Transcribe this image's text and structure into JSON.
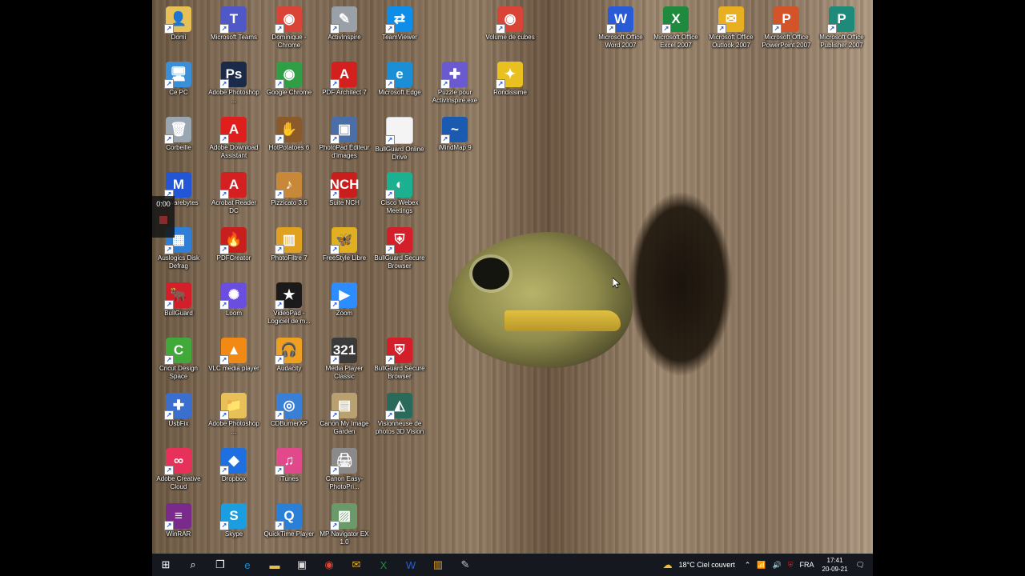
{
  "recorder": {
    "time": "0:00"
  },
  "desktop_icons": [
    {
      "col": 0,
      "row": 0,
      "label": "Domi",
      "icon": "user-folder-icon",
      "color": "#e8c058",
      "glyph": "👤"
    },
    {
      "col": 0,
      "row": 1,
      "label": "Ce PC",
      "icon": "computer-icon",
      "color": "#3a8fd8",
      "glyph": "🖥"
    },
    {
      "col": 0,
      "row": 2,
      "label": "Corbeille",
      "icon": "recycle-bin-icon",
      "color": "#9aa6b0",
      "glyph": "🗑"
    },
    {
      "col": 0,
      "row": 3,
      "label": "Malwarebytes",
      "icon": "malwarebytes-icon",
      "color": "#2256d6",
      "glyph": "M"
    },
    {
      "col": 0,
      "row": 4,
      "label": "Auslogics Disk Defrag",
      "icon": "defrag-icon",
      "color": "#2f7fd6",
      "glyph": "▦"
    },
    {
      "col": 0,
      "row": 5,
      "label": "BullGuard",
      "icon": "bullguard-icon",
      "color": "#d41f2a",
      "glyph": "🐂"
    },
    {
      "col": 0,
      "row": 6,
      "label": "Cricut Design Space",
      "icon": "cricut-icon",
      "color": "#41a83a",
      "glyph": "C"
    },
    {
      "col": 0,
      "row": 7,
      "label": "UsbFix",
      "icon": "usbfix-icon",
      "color": "#3a6fd0",
      "glyph": "✚"
    },
    {
      "col": 0,
      "row": 8,
      "label": "Adobe Creative Cloud",
      "icon": "creative-cloud-icon",
      "color": "#e8315a",
      "glyph": "∞"
    },
    {
      "col": 0,
      "row": 9,
      "label": "WinRAR",
      "icon": "winrar-icon",
      "color": "#7a2a8a",
      "glyph": "≡"
    },
    {
      "col": 1,
      "row": 0,
      "label": "Microsoft Teams",
      "icon": "teams-icon",
      "color": "#5058c8",
      "glyph": "T"
    },
    {
      "col": 1,
      "row": 1,
      "label": "Adobe Photoshop ...",
      "icon": "photoshop-icon",
      "color": "#1a2a48",
      "glyph": "Ps"
    },
    {
      "col": 1,
      "row": 2,
      "label": "Adobe Download Assistant",
      "icon": "adobe-download-icon",
      "color": "#e01e1e",
      "glyph": "A"
    },
    {
      "col": 1,
      "row": 3,
      "label": "Acrobat Reader DC",
      "icon": "acrobat-icon",
      "color": "#d42020",
      "glyph": "A"
    },
    {
      "col": 1,
      "row": 4,
      "label": "PDFCreator",
      "icon": "pdfcreator-icon",
      "color": "#c81e1e",
      "glyph": "🔥"
    },
    {
      "col": 1,
      "row": 5,
      "label": "Loom",
      "icon": "loom-icon",
      "color": "#6a4ee0",
      "glyph": "✺"
    },
    {
      "col": 1,
      "row": 6,
      "label": "VLC media player",
      "icon": "vlc-icon",
      "color": "#f08a14",
      "glyph": "▲"
    },
    {
      "col": 1,
      "row": 7,
      "label": "Adobe Photoshop ...",
      "icon": "folder-icon",
      "color": "#e8c058",
      "glyph": "📁"
    },
    {
      "col": 1,
      "row": 8,
      "label": "Dropbox",
      "icon": "dropbox-icon",
      "color": "#1e6fe0",
      "glyph": "◆"
    },
    {
      "col": 1,
      "row": 9,
      "label": "Skype",
      "icon": "skype-icon",
      "color": "#1a9ee0",
      "glyph": "S"
    },
    {
      "col": 2,
      "row": 0,
      "label": "Dominique - Chrome",
      "icon": "chrome-icon",
      "color": "#d94436",
      "glyph": "◉"
    },
    {
      "col": 2,
      "row": 1,
      "label": "Google Chrome",
      "icon": "chrome-icon",
      "color": "#2f9e44",
      "glyph": "◉"
    },
    {
      "col": 2,
      "row": 2,
      "label": "HotPotatoes 6",
      "icon": "hotpotatoes-icon",
      "color": "#8a5a2a",
      "glyph": "✋"
    },
    {
      "col": 2,
      "row": 3,
      "label": "Pizzicato 3.6",
      "icon": "pizzicato-icon",
      "color": "#c8883a",
      "glyph": "♪"
    },
    {
      "col": 2,
      "row": 4,
      "label": "PhotoFiltre 7",
      "icon": "photofiltre-icon",
      "color": "#e0a020",
      "glyph": "▥"
    },
    {
      "col": 2,
      "row": 5,
      "label": "VideoPad - Logiciel de m...",
      "icon": "videopad-icon",
      "color": "#1a1a1a",
      "glyph": "★"
    },
    {
      "col": 2,
      "row": 6,
      "label": "Audacity",
      "icon": "audacity-icon",
      "color": "#f0a020",
      "glyph": "🎧"
    },
    {
      "col": 2,
      "row": 7,
      "label": "CDBurnerXP",
      "icon": "cdburner-icon",
      "color": "#3a7fd6",
      "glyph": "◎"
    },
    {
      "col": 2,
      "row": 8,
      "label": "iTunes",
      "icon": "itunes-icon",
      "color": "#e04a8a",
      "glyph": "♫"
    },
    {
      "col": 2,
      "row": 9,
      "label": "QuickTime Player",
      "icon": "quicktime-icon",
      "color": "#2a7fd6",
      "glyph": "Q"
    },
    {
      "col": 3,
      "row": 0,
      "label": "ActivInspire",
      "icon": "activinspire-icon",
      "color": "#9aa0a8",
      "glyph": "✎"
    },
    {
      "col": 3,
      "row": 1,
      "label": "PDF Architect 7",
      "icon": "pdf-architect-icon",
      "color": "#d41f1f",
      "glyph": "A"
    },
    {
      "col": 3,
      "row": 2,
      "label": "PhotoPad Éditeur d'images",
      "icon": "photopad-icon",
      "color": "#4a6fa8",
      "glyph": "▣"
    },
    {
      "col": 3,
      "row": 3,
      "label": "Suite NCH",
      "icon": "nch-icon",
      "color": "#c81e1e",
      "glyph": "NCH"
    },
    {
      "col": 3,
      "row": 4,
      "label": "FreeStyle Libre",
      "icon": "freestyle-libre-icon",
      "color": "#e0b020",
      "glyph": "🦋"
    },
    {
      "col": 3,
      "row": 5,
      "label": "Zoom",
      "icon": "zoom-icon",
      "color": "#2d8cff",
      "glyph": "▶"
    },
    {
      "col": 3,
      "row": 6,
      "label": "Media Player Classic",
      "icon": "mpc-icon",
      "color": "#3a3a3a",
      "glyph": "321"
    },
    {
      "col": 3,
      "row": 7,
      "label": "Canon My Image Garden",
      "icon": "canon-garden-icon",
      "color": "#b8a070",
      "glyph": "▤"
    },
    {
      "col": 3,
      "row": 8,
      "label": "Canon Easy-PhotoPri...",
      "icon": "canon-printer-icon",
      "color": "#8a8a8a",
      "glyph": "🖨"
    },
    {
      "col": 3,
      "row": 9,
      "label": "MP Navigator EX 1.0",
      "icon": "mp-navigator-icon",
      "color": "#6a9a6a",
      "glyph": "▨"
    },
    {
      "col": 4,
      "row": 0,
      "label": "TeamViewer",
      "icon": "teamviewer-icon",
      "color": "#0e8ee9",
      "glyph": "⇄"
    },
    {
      "col": 4,
      "row": 1,
      "label": "Microsoft Edge",
      "icon": "edge-icon",
      "color": "#1a8fd6",
      "glyph": "e"
    },
    {
      "col": 4,
      "row": 2,
      "label": "BullGuard Online Drive",
      "icon": "document-icon",
      "color": "#f4f4f4",
      "glyph": ""
    },
    {
      "col": 4,
      "row": 3,
      "label": "Cisco Webex Meetings",
      "icon": "webex-icon",
      "color": "#1ab090",
      "glyph": "◐"
    },
    {
      "col": 4,
      "row": 4,
      "label": "BullGuard Secure Browser",
      "icon": "bullguard-browser-icon",
      "color": "#d41f2a",
      "glyph": "⛨"
    },
    {
      "col": 4,
      "row": 6,
      "label": "BullGuard Secure Browser",
      "icon": "bullguard-browser-icon",
      "color": "#d41f2a",
      "glyph": "⛨"
    },
    {
      "col": 4,
      "row": 7,
      "label": "Visionneuse de photos 3D Vision",
      "icon": "3d-vision-icon",
      "color": "#2a6a5a",
      "glyph": "◭"
    },
    {
      "col": 5,
      "row": 1,
      "label": "Puzzle pour ActivInspire.exe",
      "icon": "puzzle-icon",
      "color": "#6a5ad0",
      "glyph": "✚"
    },
    {
      "col": 5,
      "row": 2,
      "label": "iMindMap 9",
      "icon": "imindmap-icon",
      "color": "#1a5ab0",
      "glyph": "~"
    },
    {
      "col": 6,
      "row": 0,
      "label": "Volume de cubes",
      "icon": "chrome-icon",
      "color": "#d94436",
      "glyph": "◉"
    },
    {
      "col": 6,
      "row": 1,
      "label": "Rondissime",
      "icon": "rondissime-icon",
      "color": "#e8c020",
      "glyph": "✦"
    },
    {
      "col": 8,
      "row": 0,
      "label": "Microsoft Office Word 2007",
      "icon": "word-icon",
      "color": "#2a5bd7",
      "glyph": "W"
    },
    {
      "col": 9,
      "row": 0,
      "label": "Microsoft Office Excel 2007",
      "icon": "excel-icon",
      "color": "#1e8a3e",
      "glyph": "X"
    },
    {
      "col": 10,
      "row": 0,
      "label": "Microsoft Office Outlook 2007",
      "icon": "outlook-icon",
      "color": "#e8b020",
      "glyph": "✉"
    },
    {
      "col": 11,
      "row": 0,
      "label": "Microsoft Office PowerPoint 2007",
      "icon": "powerpoint-icon",
      "color": "#d4542a",
      "glyph": "P"
    },
    {
      "col": 12,
      "row": 0,
      "label": "Microsoft Office Publisher 2007",
      "icon": "publisher-icon",
      "color": "#1e8a7a",
      "glyph": "P"
    }
  ],
  "taskbar": {
    "buttons": [
      {
        "name": "start-button",
        "icon": "windows-icon",
        "glyph": "⊞",
        "color": "#ffffff"
      },
      {
        "name": "search-button",
        "icon": "search-icon",
        "glyph": "⌕",
        "color": "#ffffff"
      },
      {
        "name": "task-view-button",
        "icon": "task-view-icon",
        "glyph": "❐",
        "color": "#ffffff"
      },
      {
        "name": "edge-taskbar-button",
        "icon": "edge-icon",
        "glyph": "e",
        "color": "#1a8fd6"
      },
      {
        "name": "file-explorer-button",
        "icon": "folder-icon",
        "glyph": "▬",
        "color": "#e8c058"
      },
      {
        "name": "store-button",
        "icon": "store-icon",
        "glyph": "▣",
        "color": "#dddddd"
      },
      {
        "name": "chrome-taskbar-button",
        "icon": "chrome-icon",
        "glyph": "◉",
        "color": "#d94436"
      },
      {
        "name": "mail-taskbar-button",
        "icon": "mail-icon",
        "glyph": "✉",
        "color": "#e8b020"
      },
      {
        "name": "excel-taskbar-button",
        "icon": "excel-icon",
        "glyph": "X",
        "color": "#1e8a3e"
      },
      {
        "name": "word-taskbar-button",
        "icon": "word-icon",
        "glyph": "W",
        "color": "#2a5bd7"
      },
      {
        "name": "photofiltre-taskbar-button",
        "icon": "photofiltre-icon",
        "glyph": "▥",
        "color": "#e0a020"
      },
      {
        "name": "activinspire-taskbar-button",
        "icon": "activinspire-icon",
        "glyph": "✎",
        "color": "#c0c4c8"
      }
    ],
    "weather": "18°C  Ciel couvert",
    "language": "FRA",
    "time": "17:41",
    "date": "20-09-21"
  }
}
